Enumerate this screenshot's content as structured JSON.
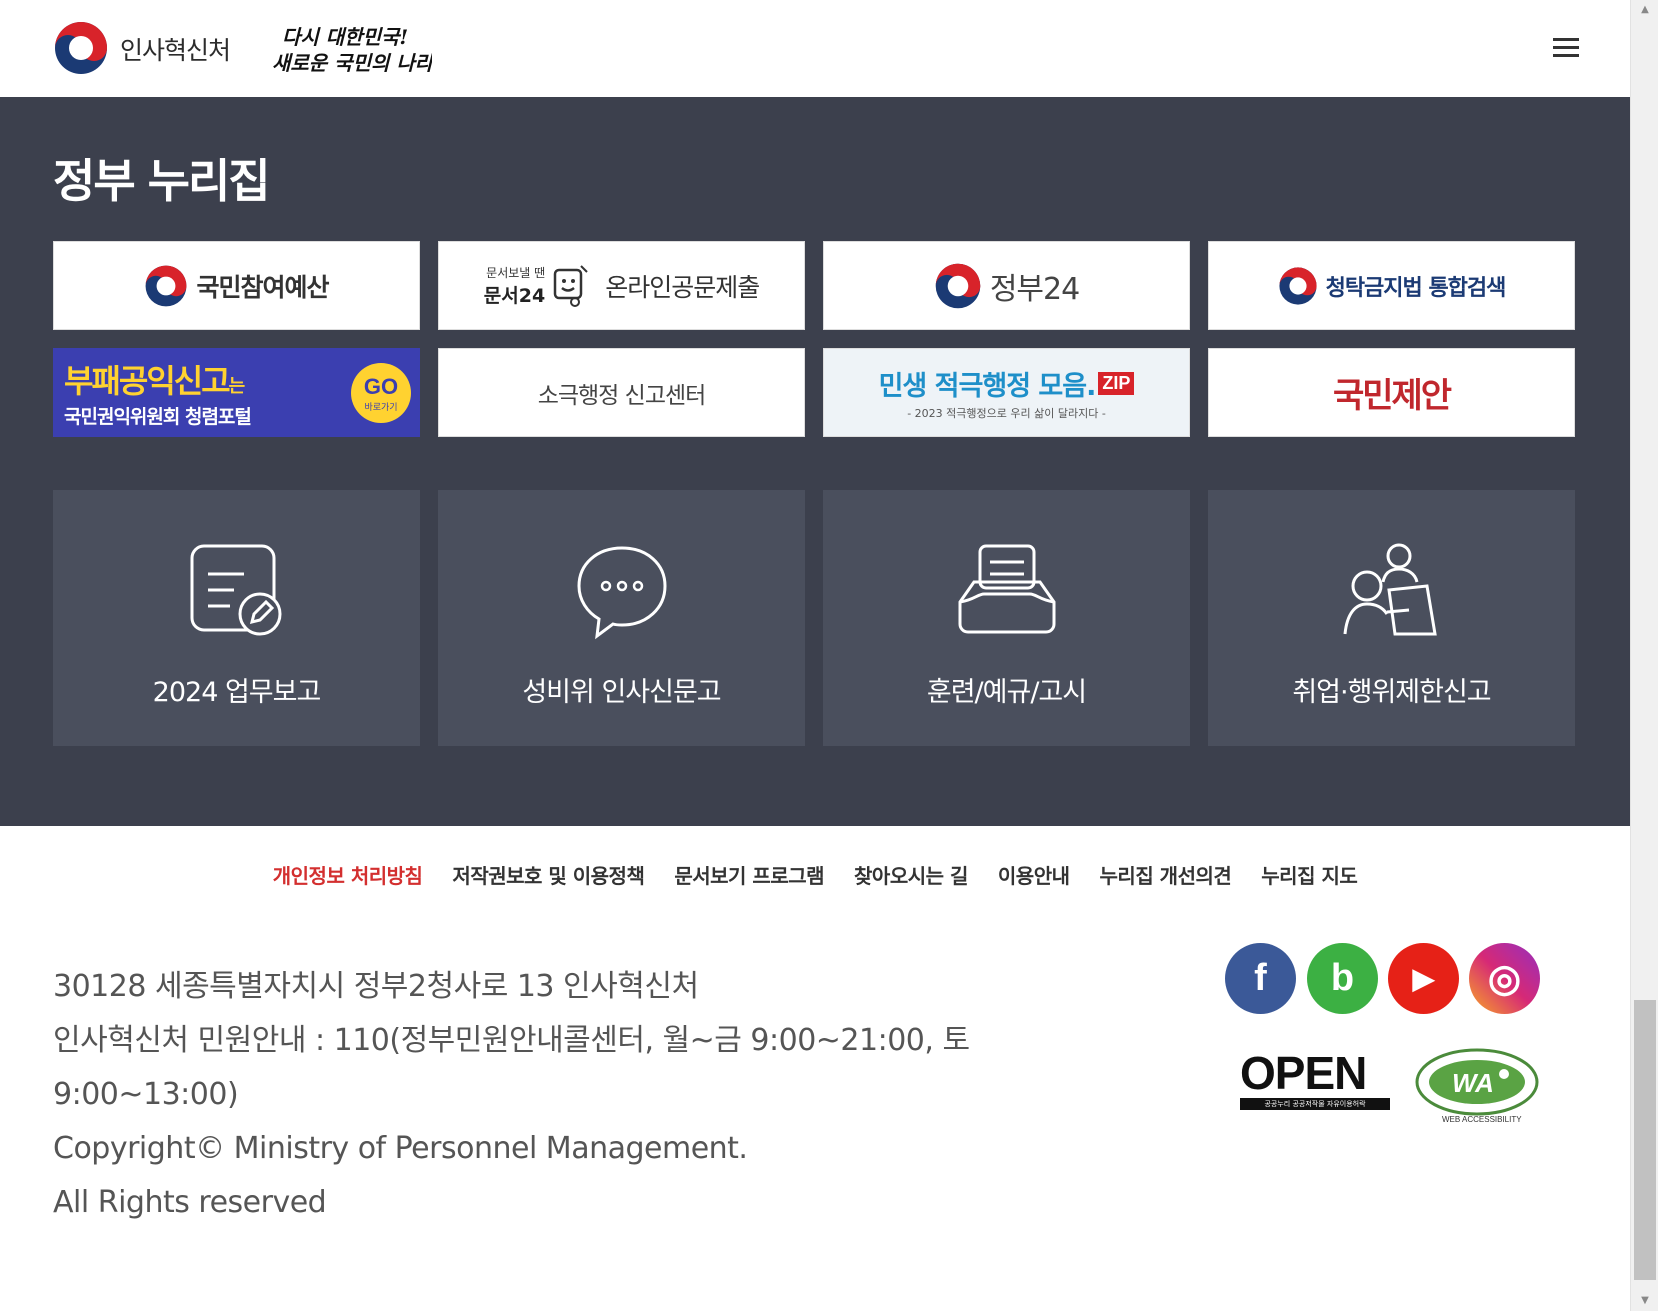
{
  "header": {
    "logo_text": "인사혁신처",
    "slogan_line1": "다시 대한민국!",
    "slogan_line2": "새로운 국민의 나라"
  },
  "portal": {
    "title": "정부 누리집",
    "banners_row1": [
      {
        "label": "국민참여예산"
      },
      {
        "label": "온라인공문제출",
        "prefix_small": "문서보낼 땐",
        "prefix_big": "문서24"
      },
      {
        "label": "정부24"
      },
      {
        "label": "청탁금지법 통합검색"
      }
    ],
    "banners_row2": [
      {
        "label": "부패공익신고",
        "suffix": "는",
        "sub": "국민권익위원회 청렴포털",
        "go": "GO",
        "go_sub": "바로가기"
      },
      {
        "label": "소극행정 신고센터"
      },
      {
        "label": "민생 적극행정 모음.",
        "badge": "ZIP",
        "sub": "- 2023 적극행정으로 우리 삶이 달라지다 -"
      },
      {
        "label": "국민제안"
      }
    ],
    "quick_links": [
      {
        "label": "2024 업무보고",
        "icon": "document-edit-icon"
      },
      {
        "label": "성비위 인사신문고",
        "icon": "chat-bubble-icon"
      },
      {
        "label": "훈련/예규/고시",
        "icon": "printer-icon"
      },
      {
        "label": "취업·행위제한신고",
        "icon": "person-clipboard-icon"
      }
    ]
  },
  "footer": {
    "links": [
      {
        "label": "개인정보 처리방침",
        "highlight": true
      },
      {
        "label": "저작권보호 및 이용정책"
      },
      {
        "label": "문서보기 프로그램"
      },
      {
        "label": "찾아오시는 길"
      },
      {
        "label": "이용안내"
      },
      {
        "label": "누리집 개선의견"
      },
      {
        "label": "누리집 지도"
      }
    ],
    "address_lines": [
      "30128 세종특별자치시 정부2청사로 13 인사혁신처",
      "인사혁신처 민원안내 : 110(정부민원안내콜센터, 월~금 9:00~21:00, 토",
      "9:00~13:00)",
      "Copyright© Ministry of Personnel Management.",
      "All Rights reserved"
    ],
    "social": [
      {
        "name": "facebook",
        "glyph": "f",
        "color": "#3b5998"
      },
      {
        "name": "blog",
        "glyph": "b",
        "color": "#3cb043"
      },
      {
        "name": "youtube",
        "glyph": "▶",
        "color": "#e62117"
      },
      {
        "name": "instagram",
        "glyph": "◎",
        "color": "#c13584"
      }
    ],
    "open_badge": "OPEN",
    "open_badge_sub": "공공누리  공공저작물 자유이용허락",
    "wa_badge": "WA",
    "wa_badge_sub": "WEB ACCESSIBILITY"
  }
}
